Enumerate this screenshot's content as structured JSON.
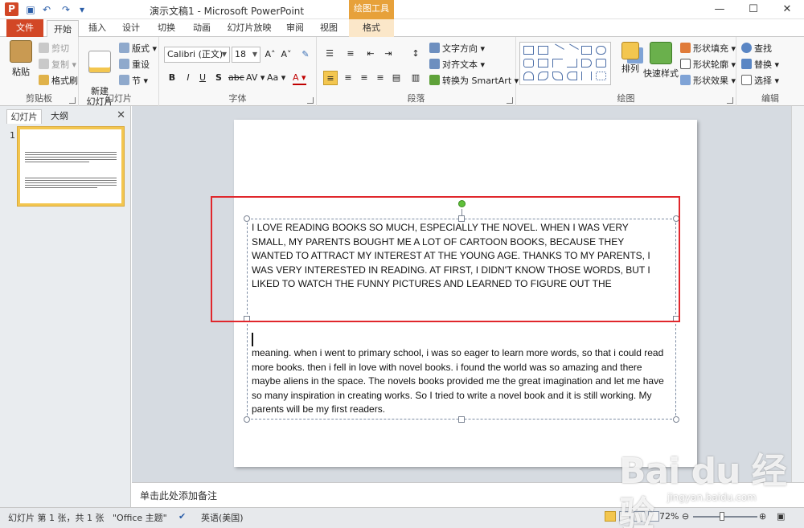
{
  "titlebar": {
    "app_logo": "P",
    "doc_title": "演示文稿1 - Microsoft PowerPoint",
    "contextual_title": "绘图工具",
    "quick_access": [
      "save-icon",
      "undo-icon",
      "redo-icon",
      "customize-icon"
    ],
    "window_controls": [
      "—",
      "☐",
      "✕"
    ]
  },
  "tabs": {
    "file": "文件",
    "items": [
      "开始",
      "插入",
      "设计",
      "切换",
      "动画",
      "幻灯片放映",
      "审阅",
      "视图"
    ],
    "context": "格式",
    "active": "开始"
  },
  "ribbon": {
    "clipboard": {
      "label": "剪贴板",
      "paste": "粘贴",
      "cut": "剪切",
      "copy": "复制 ▾",
      "format_painter": "格式刷"
    },
    "slides": {
      "label": "幻灯片",
      "new_slide": "新建\n幻灯片 ▾",
      "layout": "版式 ▾",
      "reset": "重设",
      "section": "节 ▾"
    },
    "font": {
      "label": "字体",
      "font_name": "Calibri (正文)",
      "font_size": "18",
      "bold": "B",
      "italic": "I",
      "underline": "U",
      "shadow": "S",
      "strike": "abc",
      "spacing": "AV ▾",
      "case": "Aa ▾",
      "color": "A ▾",
      "grow": "A˄",
      "shrink": "A˅",
      "clear": "✎"
    },
    "paragraph": {
      "label": "段落",
      "text_direction": "文字方向 ▾",
      "align_text": "对齐文本 ▾",
      "smartart": "转换为 SmartArt ▾"
    },
    "drawing": {
      "label": "绘图",
      "arrange": "排列",
      "quick_styles": "快速样式",
      "shape_fill": "形状填充 ▾",
      "shape_outline": "形状轮廓 ▾",
      "shape_effects": "形状效果 ▾"
    },
    "editing": {
      "label": "编辑",
      "find": "查找",
      "replace": "替换 ▾",
      "select": "选择 ▾"
    }
  },
  "left_panel": {
    "tab_slides": "幻灯片",
    "tab_outline": "大纲",
    "close": "✕",
    "slide_number": "1"
  },
  "slide": {
    "paragraph_upper": "I LOVE READING BOOKS SO MUCH, ESPECIALLY THE NOVEL. WHEN I WAS VERY SMALL, MY PARENTS BOUGHT ME A LOT OF CARTOON BOOKS, BECAUSE THEY WANTED TO ATTRACT MY INTEREST AT THE YOUNG AGE. THANKS TO MY PARENTS, I WAS VERY INTERESTED IN READING. AT FIRST, I DIDN'T KNOW THOSE WORDS, BUT I LIKED TO WATCH THE FUNNY PICTURES AND LEARNED TO FIGURE OUT THE",
    "paragraph_lower": "meaning. when i went to primary school, i was so eager to learn more words, so that i could read more books. then i fell in love with novel books. i found the world was so amazing and there maybe aliens in the space. The novels books provided me the great imagination and let me have so many inspiration in creating works. So I tried to write a novel book and it is still working. My parents will be my first readers."
  },
  "notes": {
    "placeholder": "单击此处添加备注"
  },
  "statusbar": {
    "slide_info": "幻灯片 第 1 张，共 1 张",
    "theme": "\"Office 主题\"",
    "language": "英语(美国)",
    "zoom": "72%",
    "zoom_fraction": 0.45
  },
  "watermark": {
    "brand": "Bai du 经验",
    "site": "jingyan.baidu.com"
  }
}
